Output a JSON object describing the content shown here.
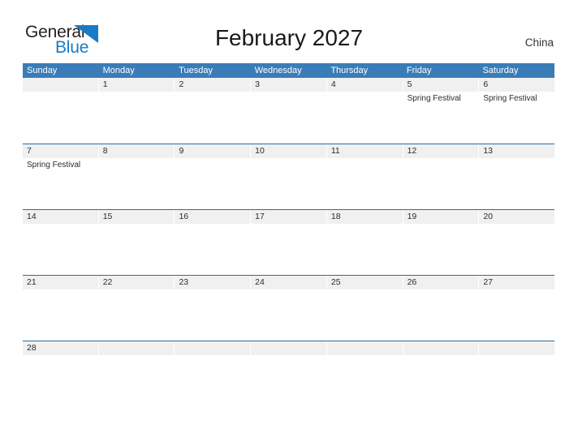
{
  "brand": {
    "word_one": "General",
    "word_two": "Blue",
    "triangle_color": "#1b7ac4",
    "text_color": "#231f20"
  },
  "header": {
    "title": "February 2027",
    "region": "China",
    "header_bg": "#3a7cb8",
    "row_divider": "#2a6ca8",
    "band_bg": "#f0f0f0"
  },
  "calendar": {
    "weekdays": [
      "Sunday",
      "Monday",
      "Tuesday",
      "Wednesday",
      "Thursday",
      "Friday",
      "Saturday"
    ],
    "weeks": [
      [
        {
          "day": "",
          "events": []
        },
        {
          "day": "1",
          "events": []
        },
        {
          "day": "2",
          "events": []
        },
        {
          "day": "3",
          "events": []
        },
        {
          "day": "4",
          "events": []
        },
        {
          "day": "5",
          "events": [
            "Spring Festival"
          ]
        },
        {
          "day": "6",
          "events": [
            "Spring Festival"
          ]
        }
      ],
      [
        {
          "day": "7",
          "events": [
            "Spring Festival"
          ]
        },
        {
          "day": "8",
          "events": []
        },
        {
          "day": "9",
          "events": []
        },
        {
          "day": "10",
          "events": []
        },
        {
          "day": "11",
          "events": []
        },
        {
          "day": "12",
          "events": []
        },
        {
          "day": "13",
          "events": []
        }
      ],
      [
        {
          "day": "14",
          "events": []
        },
        {
          "day": "15",
          "events": []
        },
        {
          "day": "16",
          "events": []
        },
        {
          "day": "17",
          "events": []
        },
        {
          "day": "18",
          "events": []
        },
        {
          "day": "19",
          "events": []
        },
        {
          "day": "20",
          "events": []
        }
      ],
      [
        {
          "day": "21",
          "events": []
        },
        {
          "day": "22",
          "events": []
        },
        {
          "day": "23",
          "events": []
        },
        {
          "day": "24",
          "events": []
        },
        {
          "day": "25",
          "events": []
        },
        {
          "day": "26",
          "events": []
        },
        {
          "day": "27",
          "events": []
        }
      ],
      [
        {
          "day": "28",
          "events": []
        },
        {
          "day": "",
          "events": []
        },
        {
          "day": "",
          "events": []
        },
        {
          "day": "",
          "events": []
        },
        {
          "day": "",
          "events": []
        },
        {
          "day": "",
          "events": []
        },
        {
          "day": "",
          "events": []
        }
      ]
    ]
  }
}
